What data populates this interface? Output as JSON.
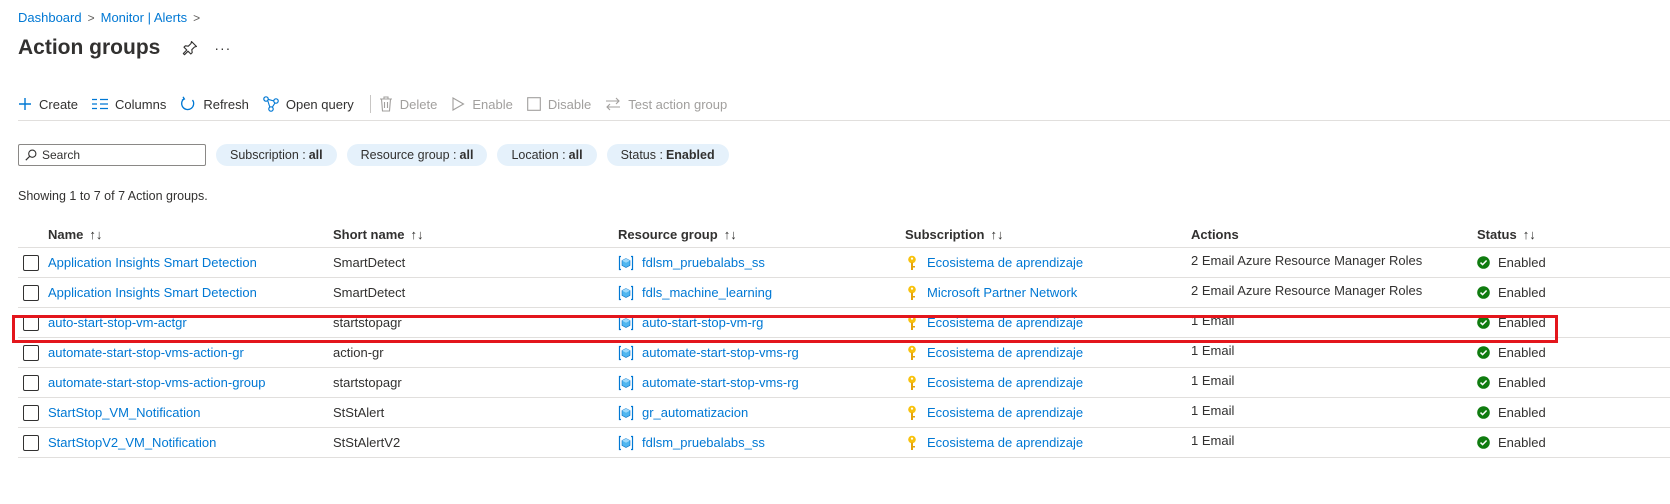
{
  "breadcrumb": {
    "items": [
      "Dashboard",
      "Monitor | Alerts"
    ]
  },
  "page": {
    "title": "Action groups"
  },
  "toolbar": {
    "create": "Create",
    "columns": "Columns",
    "refresh": "Refresh",
    "open_query": "Open query",
    "delete": "Delete",
    "enable": "Enable",
    "disable": "Disable",
    "test": "Test action group"
  },
  "filters": {
    "search_placeholder": "Search",
    "subscription": {
      "label": "Subscription :",
      "value": "all"
    },
    "resource_group": {
      "label": "Resource group :",
      "value": "all"
    },
    "location": {
      "label": "Location :",
      "value": "all"
    },
    "status": {
      "label": "Status :",
      "value": "Enabled"
    }
  },
  "showing_text": "Showing 1 to 7 of 7 Action groups.",
  "columns": {
    "name": "Name",
    "short_name": "Short name",
    "resource_group": "Resource group",
    "subscription": "Subscription",
    "actions": "Actions",
    "status": "Status",
    "sort_glyph": "↑↓"
  },
  "rows": [
    {
      "name": "Application Insights Smart Detection",
      "short_name": "SmartDetect",
      "resource_group": "fdlsm_pruebalabs_ss",
      "subscription": "Ecosistema de aprendizaje",
      "actions": "2 Email Azure Resource Manager Roles",
      "status": "Enabled"
    },
    {
      "name": "Application Insights Smart Detection",
      "short_name": "SmartDetect",
      "resource_group": "fdls_machine_learning",
      "subscription": "Microsoft Partner Network",
      "actions": "2 Email Azure Resource Manager Roles",
      "status": "Enabled"
    },
    {
      "name": "auto-start-stop-vm-actgr",
      "short_name": "startstopagr",
      "resource_group": "auto-start-stop-vm-rg",
      "subscription": "Ecosistema de aprendizaje",
      "actions": "1 Email",
      "status": "Enabled"
    },
    {
      "name": "automate-start-stop-vms-action-gr",
      "short_name": "action-gr",
      "resource_group": "automate-start-stop-vms-rg",
      "subscription": "Ecosistema de aprendizaje",
      "actions": "1 Email",
      "status": "Enabled"
    },
    {
      "name": "automate-start-stop-vms-action-group",
      "short_name": "startstopagr",
      "resource_group": "automate-start-stop-vms-rg",
      "subscription": "Ecosistema de aprendizaje",
      "actions": "1 Email",
      "status": "Enabled"
    },
    {
      "name": "StartStop_VM_Notification",
      "short_name": "StStAlert",
      "resource_group": "gr_automatizacion",
      "subscription": "Ecosistema de aprendizaje",
      "actions": "1 Email",
      "status": "Enabled"
    },
    {
      "name": "StartStopV2_VM_Notification",
      "short_name": "StStAlertV2",
      "resource_group": "fdlsm_pruebalabs_ss",
      "subscription": "Ecosistema de aprendizaje",
      "actions": "1 Email",
      "status": "Enabled"
    }
  ],
  "colors": {
    "link": "#0078d4",
    "highlight": "#e3161c",
    "enabled_green": "#107c10",
    "key_yellow": "#f8c20d",
    "pill_bg": "#e5f1fb"
  },
  "icons": {
    "pin": "pin-icon",
    "more": "more-icon",
    "resource_group": "resource-group-icon",
    "subscription": "key-icon",
    "status": "check-circle-icon"
  }
}
